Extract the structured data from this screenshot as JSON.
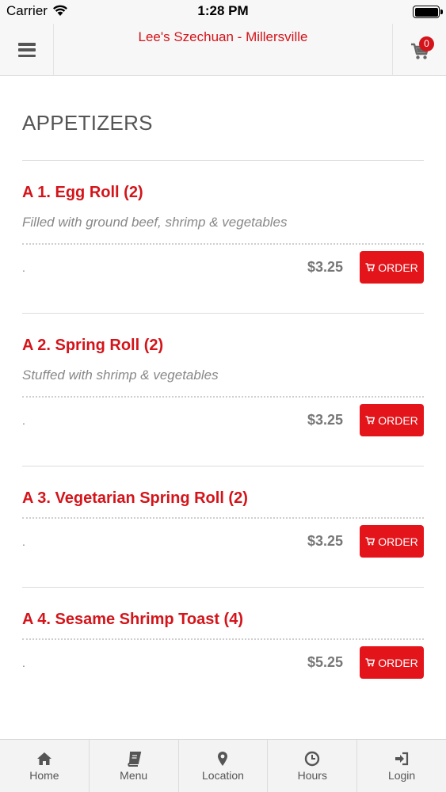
{
  "status_bar": {
    "carrier": "Carrier",
    "time": "1:28 PM"
  },
  "header": {
    "title": "Lee's Szechuan - Millersville",
    "cart_count": "0"
  },
  "section": {
    "title": "APPETIZERS"
  },
  "items": [
    {
      "name": "A 1. Egg Roll (2)",
      "description": "Filled with ground beef, shrimp & vegetables",
      "dot": ".",
      "price": "$3.25",
      "order_label": "ORDER"
    },
    {
      "name": "A 2. Spring Roll (2)",
      "description": "Stuffed with shrimp & vegetables",
      "dot": ".",
      "price": "$3.25",
      "order_label": "ORDER"
    },
    {
      "name": "A 3. Vegetarian Spring Roll (2)",
      "description": "",
      "dot": ".",
      "price": "$3.25",
      "order_label": "ORDER"
    },
    {
      "name": "A 4. Sesame Shrimp Toast (4)",
      "description": "",
      "dot": ".",
      "price": "$5.25",
      "order_label": "ORDER"
    }
  ],
  "tab_bar": {
    "tabs": [
      {
        "label": "Home",
        "icon": "home-icon"
      },
      {
        "label": "Menu",
        "icon": "book-icon"
      },
      {
        "label": "Location",
        "icon": "map-marker-icon"
      },
      {
        "label": "Hours",
        "icon": "clock-icon"
      },
      {
        "label": "Login",
        "icon": "sign-in-icon"
      }
    ]
  },
  "colors": {
    "accent": "#d4141a",
    "order_button": "#e3141a",
    "muted_text": "#888888"
  }
}
